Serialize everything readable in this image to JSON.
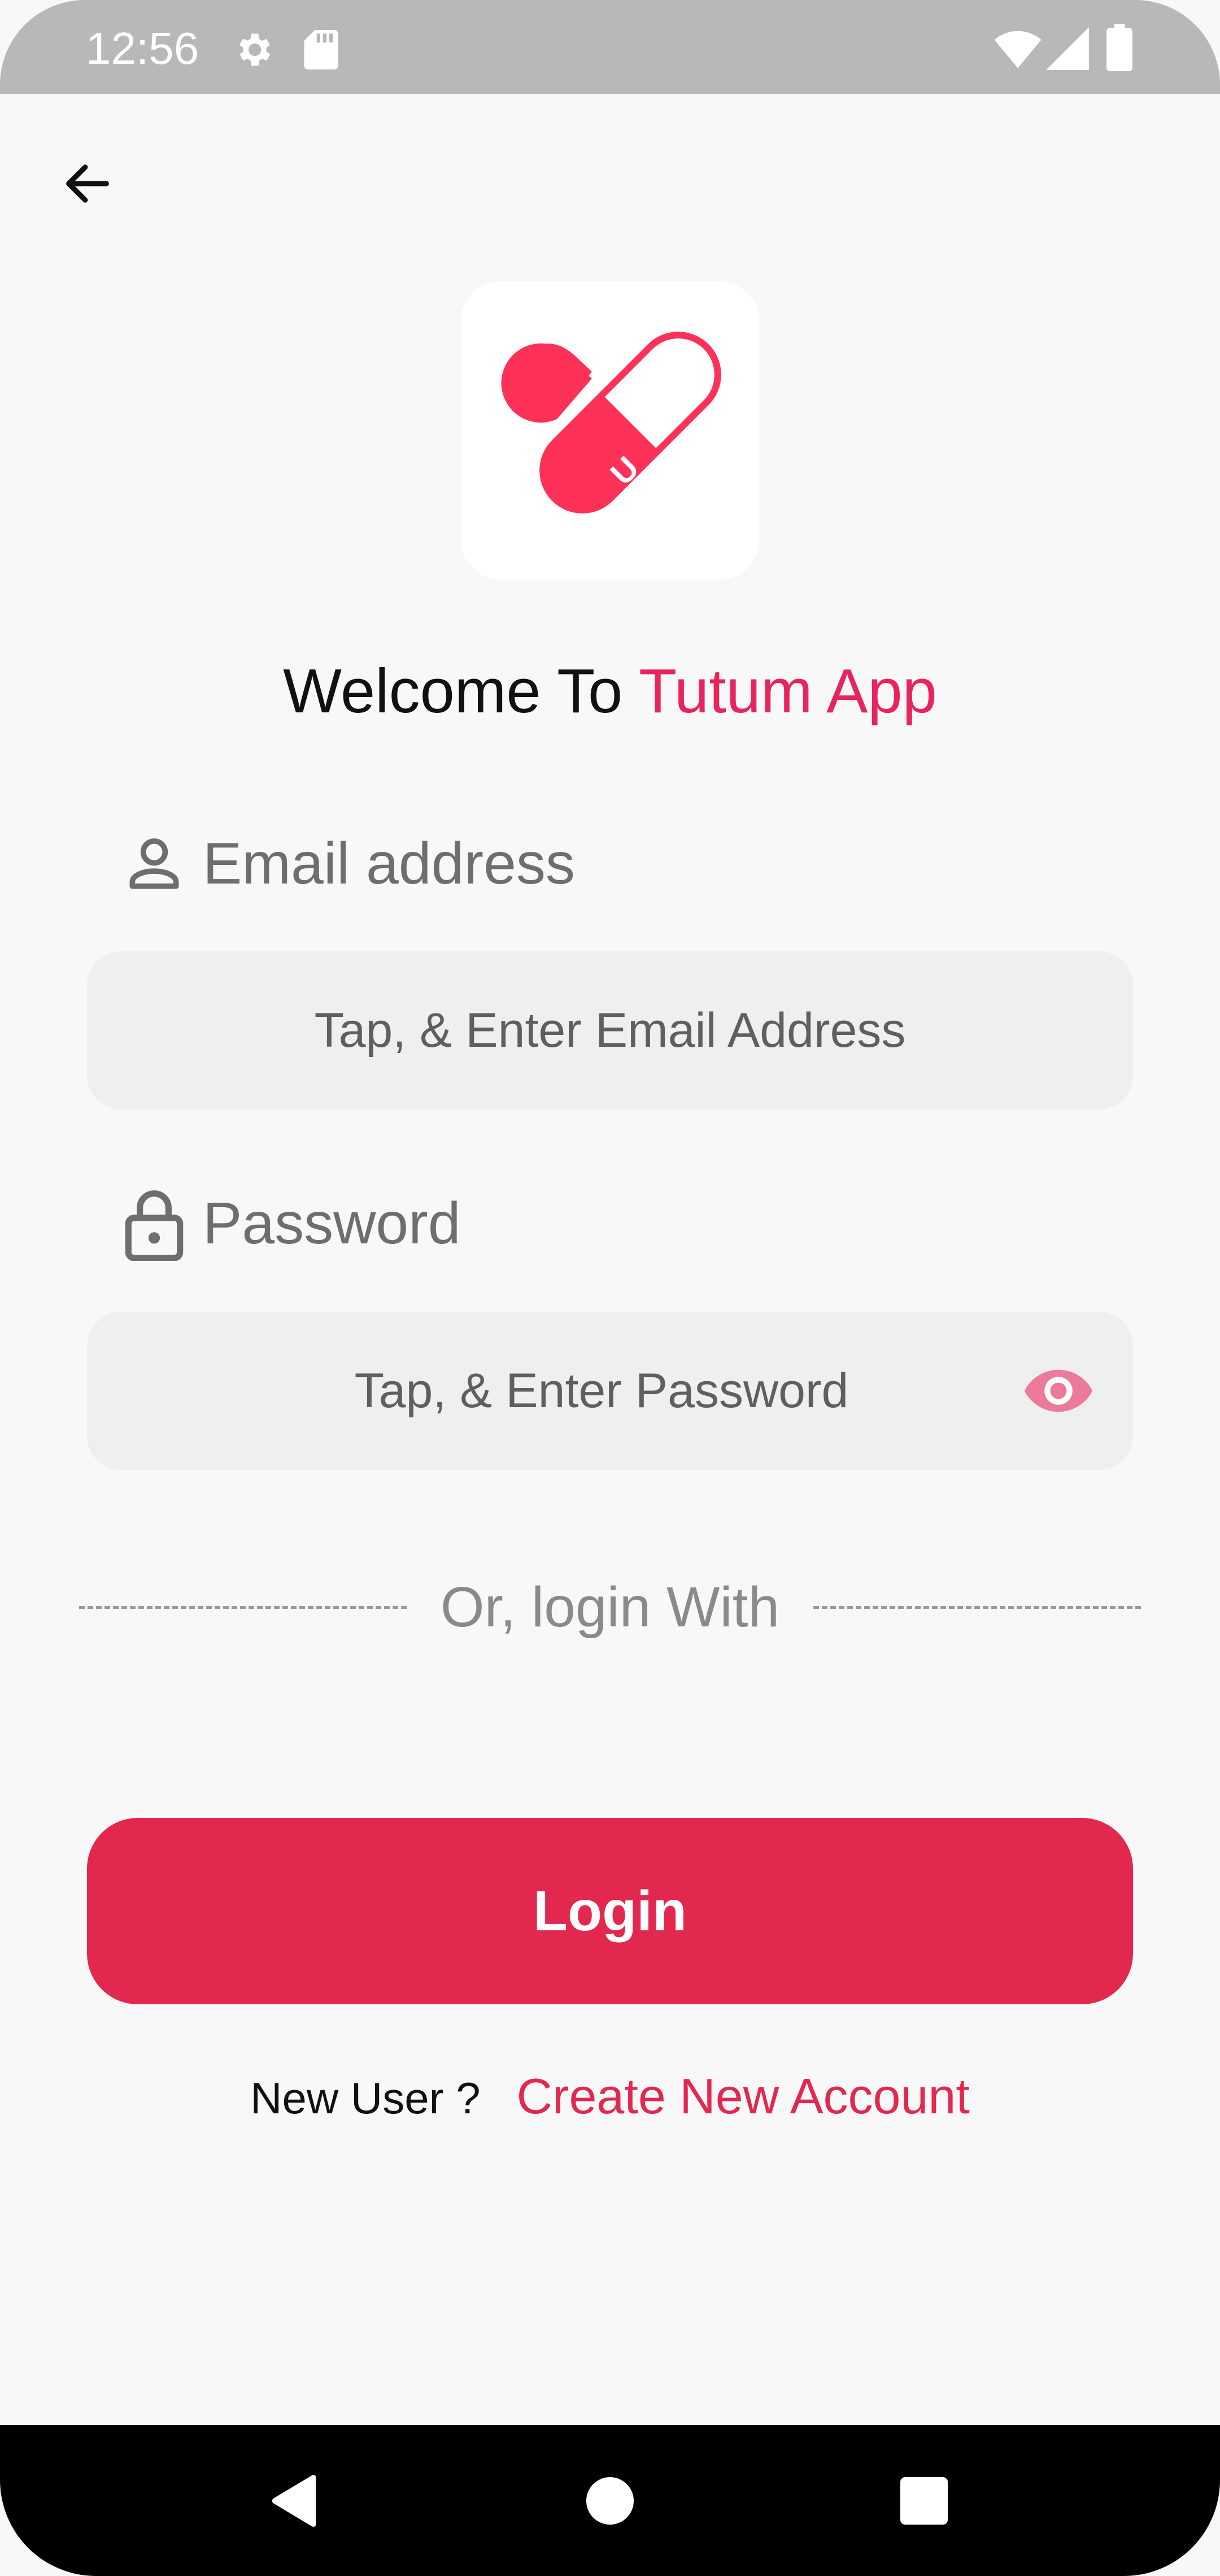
{
  "status_bar": {
    "time": "12:56",
    "icons": [
      "settings-icon",
      "sd-card-icon",
      "wifi-icon",
      "signal-icon",
      "battery-icon"
    ]
  },
  "header": {
    "back_icon": "arrow-left-icon"
  },
  "welcome": {
    "prefix": "Welcome To",
    "app_name": "Tutum App"
  },
  "form": {
    "email": {
      "label": "Email address",
      "icon": "person-icon",
      "placeholder": "Tap,  & Enter Email Address"
    },
    "password": {
      "label": "Password",
      "icon": "lock-icon",
      "placeholder": "Tap, & Enter Password",
      "toggle_icon": "eye-icon"
    }
  },
  "divider": {
    "text": "Or, login With"
  },
  "login_button": {
    "label": "Login"
  },
  "signup": {
    "question": "New User ?",
    "link": "Create New Account"
  },
  "nav_bar": {
    "icons": [
      "back-triangle-icon",
      "home-circle-icon",
      "recents-square-icon"
    ]
  },
  "colors": {
    "accent": "#e2284f",
    "brand": "#e8245c",
    "input_bg": "#efefef",
    "page_bg": "#f8f8f8"
  }
}
